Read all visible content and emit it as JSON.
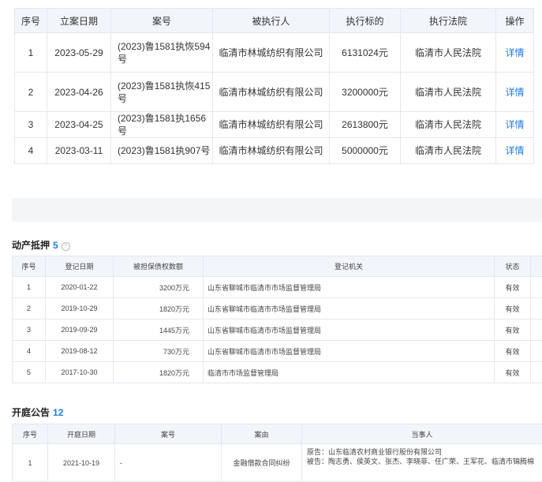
{
  "enforcement": {
    "headers": [
      "序号",
      "立案日期",
      "案号",
      "被执行人",
      "执行标的",
      "执行法院",
      "操作"
    ],
    "rows": [
      {
        "no": "1",
        "date": "2023-05-29",
        "case": "(2023)鲁1581执恢594号",
        "party": "临清市林城纺织有限公司",
        "amount": "6131024元",
        "court": "临清市人民法院",
        "action": "详情"
      },
      {
        "no": "2",
        "date": "2023-04-26",
        "case": "(2023)鲁1581执恢415号",
        "party": "临清市林城纺织有限公司",
        "amount": "3200000元",
        "court": "临清市人民法院",
        "action": "详情"
      },
      {
        "no": "3",
        "date": "2023-04-25",
        "case": "(2023)鲁1581执1656号",
        "party": "临清市林城纺织有限公司",
        "amount": "2613800元",
        "court": "临清市人民法院",
        "action": "详情"
      },
      {
        "no": "4",
        "date": "2023-03-11",
        "case": "(2023)鲁1581执907号",
        "party": "临清市林城纺织有限公司",
        "amount": "5000000元",
        "court": "临清市人民法院",
        "action": "详情"
      }
    ]
  },
  "chattel": {
    "title": "动产抵押",
    "count": "5",
    "help_icon": "?",
    "headers": [
      "序号",
      "登记日期",
      "被担保债权数额",
      "登记机关",
      "状态"
    ],
    "rows": [
      {
        "no": "1",
        "date": "2020-01-22",
        "amount": "3200万元",
        "org": "山东省聊城市临清市市场监督管理局",
        "status": "有效"
      },
      {
        "no": "2",
        "date": "2019-10-29",
        "amount": "1820万元",
        "org": "山东省聊城市临清市市场监督管理局",
        "status": "有效"
      },
      {
        "no": "3",
        "date": "2019-09-29",
        "amount": "1445万元",
        "org": "山东省聊城市临清市市场监督管理局",
        "status": "有效"
      },
      {
        "no": "4",
        "date": "2019-08-12",
        "amount": "730万元",
        "org": "山东省聊城市临清市市场监督管理局",
        "status": "有效"
      },
      {
        "no": "5",
        "date": "2017-10-30",
        "amount": "1820万元",
        "org": "临清市市场监督管理局",
        "status": "有效"
      }
    ]
  },
  "hearing": {
    "title": "开庭公告",
    "count": "12",
    "headers": [
      "序号",
      "开庭日期",
      "案号",
      "案由",
      "当事人"
    ],
    "rows": [
      {
        "no": "1",
        "date": "2021-10-19",
        "case": "-",
        "cause": "金融借款合同纠纷",
        "plaintiff": "原告：山东临清农村商业银行股份有限公司",
        "defendant": "被告：陶志勇、侯英文、张杰、李晓菲、任广荣、王军花、临清市锦腾棉"
      }
    ]
  }
}
